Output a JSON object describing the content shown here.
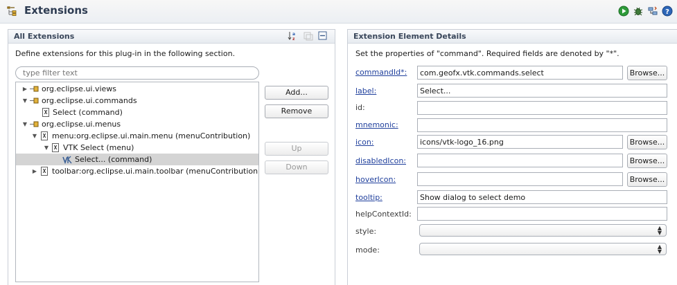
{
  "header": {
    "title": "Extensions"
  },
  "left": {
    "title": "All Extensions",
    "description": "Define extensions for this plug-in in the following section.",
    "filter_placeholder": "type filter text",
    "tree": [
      {
        "label": "org.eclipse.ui.views"
      },
      {
        "label": "org.eclipse.ui.commands"
      },
      {
        "label": "Select (command)"
      },
      {
        "label": "org.eclipse.ui.menus"
      },
      {
        "label": "menu:org.eclipse.ui.main.menu (menuContribution)"
      },
      {
        "label": "VTK Select (menu)"
      },
      {
        "label": "Select... (command)"
      },
      {
        "label": "toolbar:org.eclipse.ui.main.toolbar (menuContribution)"
      }
    ],
    "buttons": {
      "add": "Add...",
      "remove": "Remove",
      "up": "Up",
      "down": "Down"
    }
  },
  "right": {
    "title": "Extension Element Details",
    "description": "Set the properties of \"command\". Required fields are denoted by \"*\".",
    "fields": {
      "commandId": {
        "label": "commandId*:",
        "value": "com.geofx.vtk.commands.select"
      },
      "label": {
        "label": "label:",
        "value": "Select..."
      },
      "id": {
        "label": "id:",
        "value": ""
      },
      "mnemonic": {
        "label": "mnemonic:",
        "value": ""
      },
      "icon": {
        "label": "icon:",
        "value": "icons/vtk-logo_16.png"
      },
      "disabledIcon": {
        "label": "disabledIcon:",
        "value": ""
      },
      "hoverIcon": {
        "label": "hoverIcon:",
        "value": ""
      },
      "tooltip": {
        "label": "tooltip:",
        "value": "Show dialog to select demo"
      },
      "helpContextId": {
        "label": "helpContextId:",
        "value": ""
      },
      "style": {
        "label": "style:",
        "value": ""
      },
      "mode": {
        "label": "mode:",
        "value": ""
      }
    },
    "browse_label": "Browse..."
  }
}
